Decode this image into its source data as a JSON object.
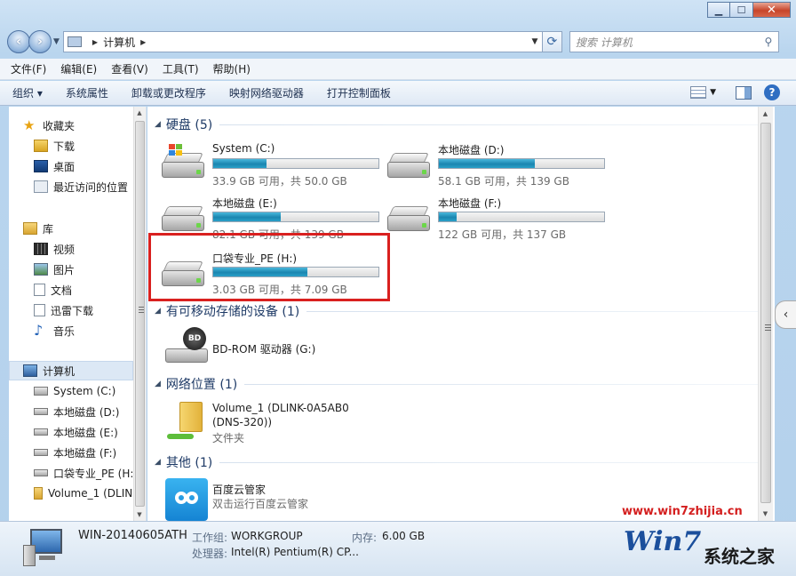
{
  "address": {
    "crumb": "计算机"
  },
  "search": {
    "placeholder": "搜索 计算机"
  },
  "menu": [
    "文件(F)",
    "编辑(E)",
    "查看(V)",
    "工具(T)",
    "帮助(H)"
  ],
  "commands": {
    "organize": "组织",
    "items": [
      "系统属性",
      "卸载或更改程序",
      "映射网络驱动器",
      "打开控制面板"
    ]
  },
  "sidebar": {
    "favorites": "收藏夹",
    "fav_items": [
      "下载",
      "桌面",
      "最近访问的位置"
    ],
    "libraries": "库",
    "lib_items": [
      "视频",
      "图片",
      "文档",
      "迅雷下载",
      "音乐"
    ],
    "computer": "计算机",
    "comp_items": [
      "System (C:)",
      "本地磁盘 (D:)",
      "本地磁盘 (E:)",
      "本地磁盘 (F:)",
      "口袋专业_PE (H:)",
      "Volume_1 (DLIN"
    ]
  },
  "groups": {
    "hdd": "硬盘 (5)",
    "removable": "有可移动存储的设备 (1)",
    "network": "网络位置 (1)",
    "other": "其他 (1)"
  },
  "drives": [
    {
      "name": "System (C:)",
      "size": "33.9 GB 可用，共 50.0 GB",
      "used_fraction": 0.32
    },
    {
      "name": "本地磁盘 (D:)",
      "size": "58.1 GB 可用，共 139 GB",
      "used_fraction": 0.58
    },
    {
      "name": "本地磁盘 (E:)",
      "size": "82.1 GB 可用，共 139 GB",
      "used_fraction": 0.41
    },
    {
      "name": "本地磁盘 (F:)",
      "size": "122 GB 可用，共 137 GB",
      "used_fraction": 0.11
    },
    {
      "name": "口袋专业_PE (H:)",
      "size": "3.03 GB 可用，共 7.09 GB",
      "used_fraction": 0.57
    }
  ],
  "removable_item": {
    "name": "BD-ROM 驱动器 (G:)",
    "badge": "BD"
  },
  "network_item": {
    "name1": "Volume_1 (DLINK-0A5AB0",
    "name2": "(DNS-320))",
    "type": "文件夹"
  },
  "other_item": {
    "name": "百度云管家",
    "desc": "双击运行百度云管家"
  },
  "details": {
    "host": "WIN-20140605ATH",
    "workgroup_label": "工作组:",
    "workgroup": "WORKGROUP",
    "memory_label": "内存:",
    "memory": "6.00 GB",
    "cpu_label": "处理器:",
    "cpu": "Intel(R) Pentium(R) CP..."
  },
  "watermark": {
    "url": "www.win7zhijia.cn",
    "logo": "Win7",
    "brand": "系统之家"
  },
  "colors": {
    "accent": "#1b86b0",
    "highlight": "#d9201f"
  }
}
